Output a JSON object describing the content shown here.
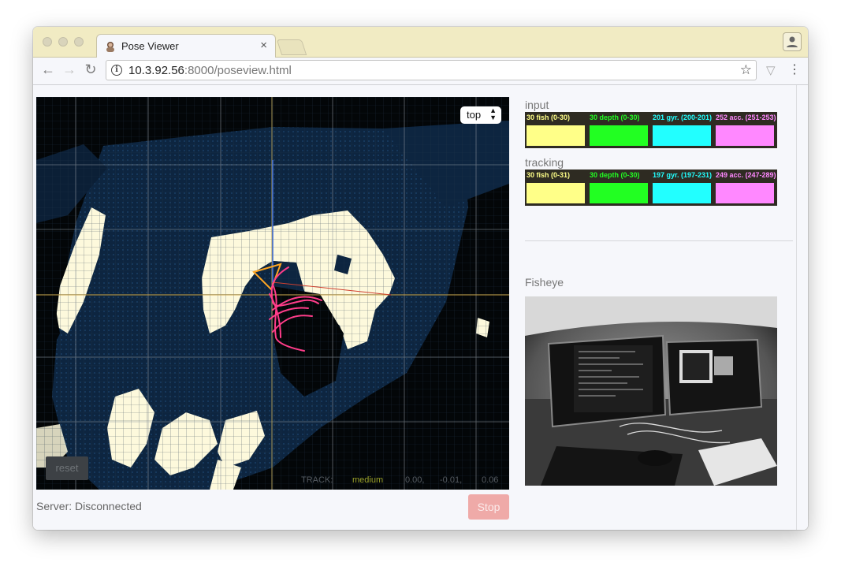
{
  "browser": {
    "tab_title": "Pose Viewer",
    "tab_close": "×",
    "url_host": "10.3.92.56",
    "url_rest": ":8000/poseview.html",
    "nav": {
      "back": "←",
      "forward": "→",
      "reload": "↻",
      "info": "i",
      "star": "☆",
      "menu": "⋮",
      "ext": "▽"
    }
  },
  "viewer": {
    "view_mode": "top",
    "view_arrows": "▲▼",
    "reset_label": "reset",
    "track_label": "TRACK:",
    "track_quality": "medium",
    "track_values": [
      "0.00,",
      "-0.01,",
      "0.06"
    ]
  },
  "server_status": "Server: Disconnected",
  "stop_label": "Stop",
  "input": {
    "title": "input",
    "cells": [
      {
        "label": "30 fish (0-30)",
        "color": "#ffff88"
      },
      {
        "label": "30 depth (0-30)",
        "color": "#22ff22"
      },
      {
        "label": "201 gyr. (200-201)",
        "color": "#22ffff"
      },
      {
        "label": "252 acc. (251-253)",
        "color": "#ff88ff"
      }
    ]
  },
  "tracking": {
    "title": "tracking",
    "cells": [
      {
        "label": "30 fish (0-31)",
        "color": "#ffff88"
      },
      {
        "label": "30 depth (0-30)",
        "color": "#22ff22"
      },
      {
        "label": "197 gyr. (197-231)",
        "color": "#22ffff"
      },
      {
        "label": "249 acc. (247-289)",
        "color": "#ff88ff"
      }
    ]
  },
  "fisheye": {
    "title": "Fisheye"
  },
  "colors": {
    "map_blue": "#0d2540",
    "map_occupied": "#fdf9dc",
    "trajectory": "#ff3d8a",
    "camera": "#ffa623",
    "stop": "#efaaa8"
  }
}
